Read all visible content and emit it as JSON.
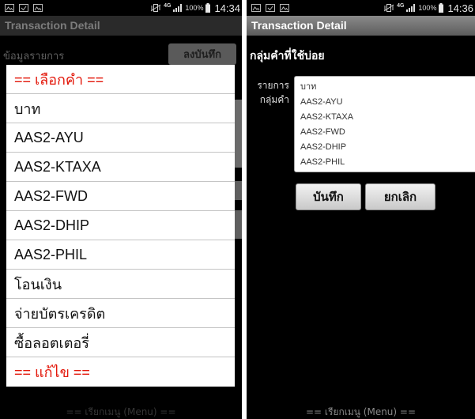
{
  "colors": {
    "accent": "#e3170a",
    "dialog_background": "#ffffff",
    "title_bar_active": "#6e6e6e",
    "button_face": "#dddddd"
  },
  "left_screen": {
    "status_bar": {
      "notification_icons": [
        "image-icon",
        "download-done-icon",
        "image-icon"
      ],
      "system_icons": [
        "vibrate-icon",
        "signal-icon",
        "battery-icon"
      ],
      "network": "4G",
      "battery": "100%",
      "time": "14:34"
    },
    "title": "Transaction Detail",
    "background_section_label": "ข้อมูลรายการ",
    "background_button_label": "ลงบันทึก",
    "dialog": {
      "items": [
        {
          "label": "== เลือกคำ ==",
          "accent": true
        },
        {
          "label": "บาท"
        },
        {
          "label": "AAS2-AYU"
        },
        {
          "label": "AAS2-KTAXA"
        },
        {
          "label": "AAS2-FWD"
        },
        {
          "label": "AAS2-DHIP"
        },
        {
          "label": "AAS2-PHIL"
        },
        {
          "label": "โอนเงิน"
        },
        {
          "label": "จ่ายบัตรเครดิต"
        },
        {
          "label": "ซื้อลอตเตอรี่"
        },
        {
          "label": "== แก้ไข ==",
          "accent": true
        }
      ]
    },
    "menu_hint": "== เรียกเมนู (Menu) =="
  },
  "right_screen": {
    "status_bar": {
      "notification_icons": [
        "image-icon",
        "download-done-icon",
        "image-icon"
      ],
      "system_icons": [
        "vibrate-icon",
        "signal-icon",
        "battery-icon"
      ],
      "network": "4G",
      "battery": "100%",
      "time": "14:36"
    },
    "title": "Transaction Detail",
    "heading": "กลุ่มคำที่ใช้บ่อย",
    "field_label": {
      "line1": "รายการ",
      "line2": "กลุ่มคำ"
    },
    "word_group_lines": [
      "บาท",
      "AAS2-AYU",
      "AAS2-KTAXA",
      "AAS2-FWD",
      "AAS2-DHIP",
      "AAS2-PHIL"
    ],
    "save_button": "บันทึก",
    "cancel_button": "ยกเลิก",
    "menu_hint": "== เรียกเมนู (Menu) =="
  }
}
